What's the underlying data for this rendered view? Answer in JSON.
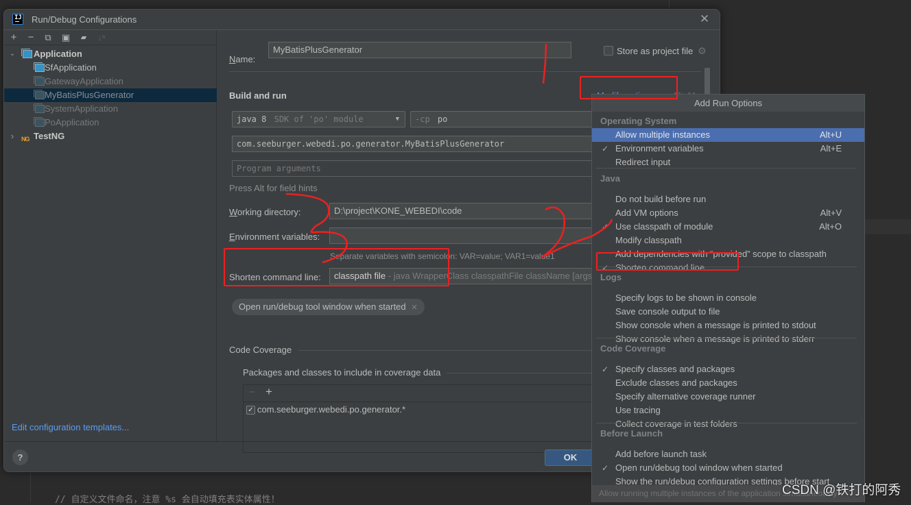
{
  "editor": {
    "code_line": "// 自定义文件命名，注意 %s 会自动填充表实体属性！"
  },
  "dialog": {
    "title": "Run/Debug Configurations",
    "logo_text": "IJ",
    "close_glyph": "✕"
  },
  "toolbar": {
    "add": "+",
    "remove": "−",
    "copy": "⧉",
    "save": "▣",
    "new_folder": "▰",
    "sort": "↓ᵃ"
  },
  "tree": {
    "groups": [
      {
        "label": "Application",
        "expanded": true,
        "children": [
          {
            "label": "SfApplication",
            "temporary": false,
            "selected": false
          },
          {
            "label": "GatewayApplication",
            "temporary": true,
            "selected": false
          },
          {
            "label": "MyBatisPlusGenerator",
            "temporary": true,
            "selected": true
          },
          {
            "label": "SystemApplication",
            "temporary": true,
            "selected": false
          },
          {
            "label": "PoApplication",
            "temporary": true,
            "selected": false
          }
        ]
      },
      {
        "label": "TestNG",
        "expanded": false,
        "icon": "NG"
      }
    ],
    "arrow_expanded": "⌄",
    "arrow_collapsed": "›"
  },
  "edit_templates_link": "Edit configuration templates...",
  "form": {
    "name_label": "Name:",
    "name_value": "MyBatisPlusGenerator",
    "store_label": "Store as project file",
    "store_checked": false,
    "build_run_title": "Build and run",
    "modify_options": "Modify options",
    "modify_shortcut": "Alt+M",
    "jdk_value": "java 8",
    "jdk_detail": "SDK of 'po' module",
    "cp_flag": "-cp",
    "cp_value": "po",
    "main_class": "com.seeburger.webedi.po.generator.MyBatisPlusGenerator",
    "program_args_placeholder": "Program arguments",
    "hint": "Press Alt for field hints",
    "working_dir_label": "Working directory:",
    "working_dir_value": "D:\\project\\KONE_WEBEDI\\code",
    "env_label": "Environment variables:",
    "env_value": "",
    "env_hint": "Separate variables with semicolon: VAR=value; VAR1=value1",
    "shorten_label": "Shorten command line:",
    "shorten_value": "classpath file",
    "shorten_detail": " - java WrapperClass classpathFile className [args]",
    "chip_label": "Open run/debug tool window when started",
    "chip_close": "✕",
    "coverage_title": "Code Coverage",
    "packages_title": "Packages and classes to include in coverage data",
    "packages": [
      {
        "pattern": "com.seeburger.webedi.po.generator.*",
        "checked": true
      }
    ]
  },
  "footer": {
    "help": "?",
    "ok": "OK"
  },
  "popup": {
    "title": "Add Run Options",
    "sections": [
      {
        "title": "Operating System",
        "items": [
          {
            "label": "Allow multiple instances",
            "shortcut": "Alt+U",
            "checked": false,
            "highlighted": true
          },
          {
            "label": "Environment variables",
            "shortcut": "Alt+E",
            "checked": true
          },
          {
            "label": "Redirect input",
            "shortcut": "",
            "checked": false
          }
        ]
      },
      {
        "title": "Java",
        "items": [
          {
            "label": "Do not build before run",
            "shortcut": "",
            "checked": false
          },
          {
            "label": "Add VM options",
            "shortcut": "Alt+V",
            "checked": false
          },
          {
            "label": "Use classpath of module",
            "shortcut": "Alt+O",
            "checked": true
          },
          {
            "label": "Modify classpath",
            "shortcut": "",
            "checked": false
          },
          {
            "label": "Add dependencies with “provided” scope to classpath",
            "shortcut": "",
            "checked": false
          },
          {
            "label": "Shorten command line",
            "shortcut": "",
            "checked": true
          }
        ]
      },
      {
        "title": "Logs",
        "items": [
          {
            "label": "Specify logs to be shown in console",
            "shortcut": "",
            "checked": false
          },
          {
            "label": "Save console output to file",
            "shortcut": "",
            "checked": false
          },
          {
            "label": "Show console when a message is printed to stdout",
            "shortcut": "",
            "checked": false
          },
          {
            "label": "Show console when a message is printed to stderr",
            "shortcut": "",
            "checked": false
          }
        ]
      },
      {
        "title": "Code Coverage",
        "items": [
          {
            "label": "Specify classes and packages",
            "shortcut": "",
            "checked": true
          },
          {
            "label": "Exclude classes and packages",
            "shortcut": "",
            "checked": false
          },
          {
            "label": "Specify alternative coverage runner",
            "shortcut": "",
            "checked": false
          },
          {
            "label": "Use tracing",
            "shortcut": "",
            "checked": false
          },
          {
            "label": "Collect coverage in test folders",
            "shortcut": "",
            "checked": false
          }
        ]
      },
      {
        "title": "Before Launch",
        "items": [
          {
            "label": "Add before launch task",
            "shortcut": "",
            "checked": false
          },
          {
            "label": "Open run/debug tool window when started",
            "shortcut": "",
            "checked": true
          },
          {
            "label": "Show the run/debug configuration settings before start",
            "shortcut": "",
            "checked": false
          }
        ]
      }
    ],
    "status": "Allow running multiple instances of the application simultaneously",
    "check_glyph": "✓"
  },
  "annotations": {
    "color": "#ee2020",
    "marks": [
      "1",
      "2",
      "3"
    ]
  },
  "watermark": "CSDN @铁打的阿秀"
}
